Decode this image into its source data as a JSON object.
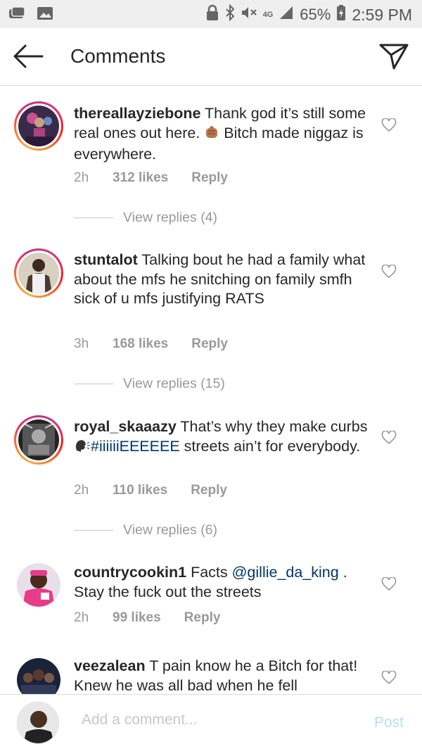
{
  "status_bar": {
    "battery_percent": "65%",
    "time": "2:59 PM",
    "network": "4G"
  },
  "header": {
    "title": "Comments"
  },
  "comments": [
    {
      "username": "thereallayziebone",
      "text_before": " Thank god it’s still some real ones out here. ",
      "text_after": " Bitch made niggaz is everywhere.",
      "emoji": "fist-emoji",
      "time": "2h",
      "likes": "312 likes",
      "reply_label": "Reply",
      "view_replies": "View replies (4)"
    },
    {
      "username": "stuntalot",
      "text": " Talking bout he had a family what about the mfs he snitching on family smfh sick of u mfs justifying RATS",
      "time": "3h",
      "likes": "168 likes",
      "reply_label": "Reply",
      "view_replies": "View replies (15)"
    },
    {
      "username": "royal_skaaazy",
      "text_before": " That’s why they make curbs ",
      "hashtag": "#iiiiiiEEEEEE",
      "text_after": " streets ain’t for everybody.",
      "emoji": "speaking-head-emoji",
      "time": "2h",
      "likes": "110 likes",
      "reply_label": "Reply",
      "view_replies": "View replies (6)"
    },
    {
      "username": "countrycookin1",
      "text_before": " Facts ",
      "mention": "@gillie_da_king",
      "text_after": " . Stay the fuck out the streets",
      "time": "2h",
      "likes": "99 likes",
      "reply_label": "Reply"
    },
    {
      "username": "veezalean",
      "text": " T pain know he a Bitch for that! Knew he was all bad when he fell"
    }
  ],
  "add_comment": {
    "placeholder": "Add a comment...",
    "post_label": "Post"
  },
  "colors": {
    "link": "#003569",
    "muted": "#999999",
    "post_disabled": "#b2dffc"
  }
}
